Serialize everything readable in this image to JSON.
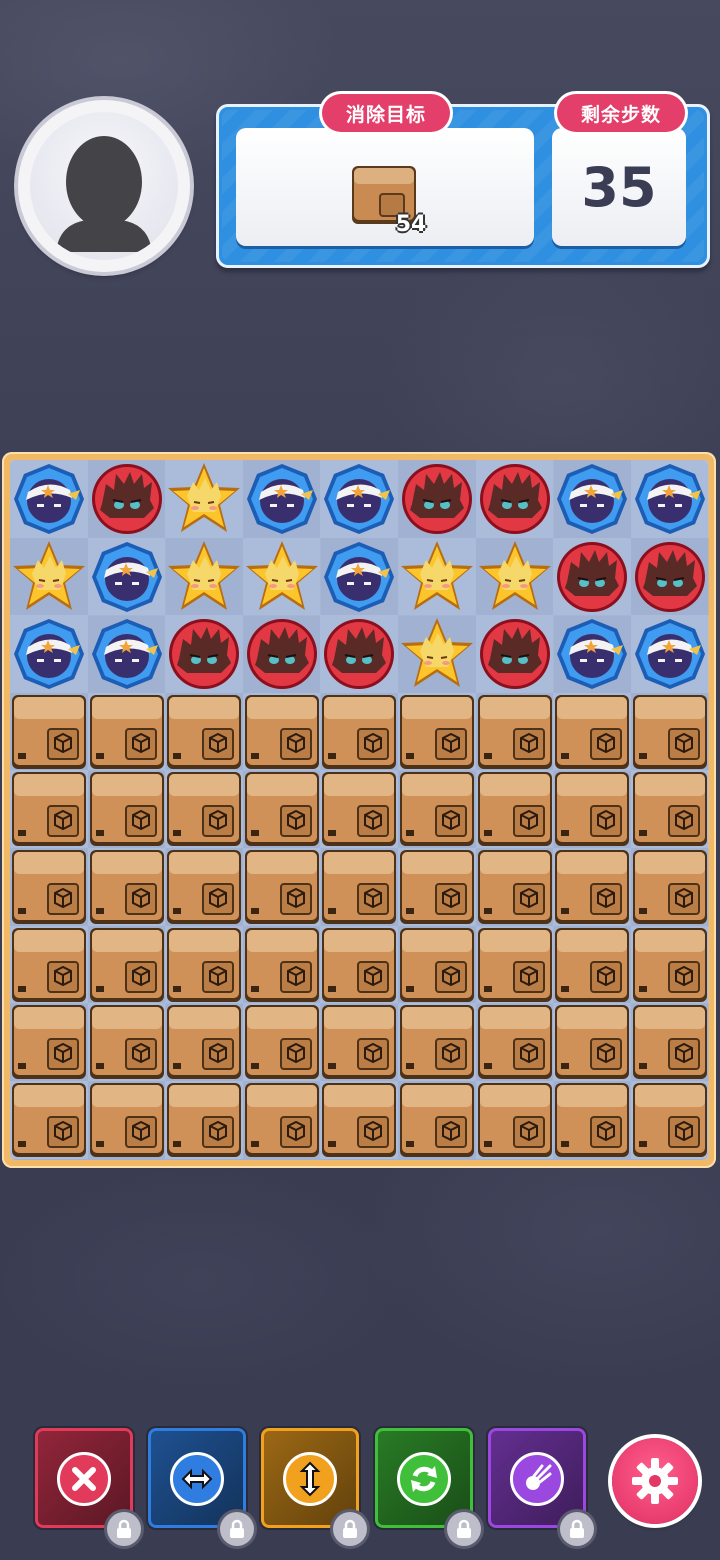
{
  "header": {
    "goal_label": "消除目标",
    "moves_label": "剩余步数",
    "goal_item_icon": "cardboard-box-icon",
    "goal_count": "54",
    "moves_left": "35"
  },
  "board": {
    "rows": 9,
    "cols": 9,
    "grid": [
      [
        "blue",
        "red",
        "yellow",
        "blue",
        "blue",
        "red",
        "red",
        "blue",
        "blue"
      ],
      [
        "yellow",
        "blue",
        "yellow",
        "yellow",
        "blue",
        "yellow",
        "yellow",
        "red",
        "red"
      ],
      [
        "blue",
        "blue",
        "red",
        "red",
        "red",
        "yellow",
        "red",
        "blue",
        "blue"
      ],
      [
        "box",
        "box",
        "box",
        "box",
        "box",
        "box",
        "box",
        "box",
        "box"
      ],
      [
        "box",
        "box",
        "box",
        "box",
        "box",
        "box",
        "box",
        "box",
        "box"
      ],
      [
        "box",
        "box",
        "box",
        "box",
        "box",
        "box",
        "box",
        "box",
        "box"
      ],
      [
        "box",
        "box",
        "box",
        "box",
        "box",
        "box",
        "box",
        "box",
        "box"
      ],
      [
        "box",
        "box",
        "box",
        "box",
        "box",
        "box",
        "box",
        "box",
        "box"
      ],
      [
        "box",
        "box",
        "box",
        "box",
        "box",
        "box",
        "box",
        "box",
        "box"
      ]
    ],
    "piece_types": {
      "blue": "blue-ninja-piece",
      "red": "red-spiky-piece",
      "yellow": "yellow-star-piece",
      "box": "cardboard-box-tile"
    }
  },
  "toolbar": {
    "tools": [
      {
        "name": "remove-tool",
        "icon": "cross-icon",
        "color": "#e23a5a",
        "locked": true
      },
      {
        "name": "swap-horizontal-tool",
        "icon": "horizontal-arrows-icon",
        "color": "#2f7de0",
        "locked": true
      },
      {
        "name": "swap-vertical-tool",
        "icon": "vertical-arrows-icon",
        "color": "#f2a11f",
        "locked": true
      },
      {
        "name": "shuffle-tool",
        "icon": "refresh-icon",
        "color": "#3fbf3a",
        "locked": true
      },
      {
        "name": "magic-tool",
        "icon": "comet-icon",
        "color": "#9a48e0",
        "locked": true
      }
    ],
    "settings_icon": "gear-icon"
  }
}
